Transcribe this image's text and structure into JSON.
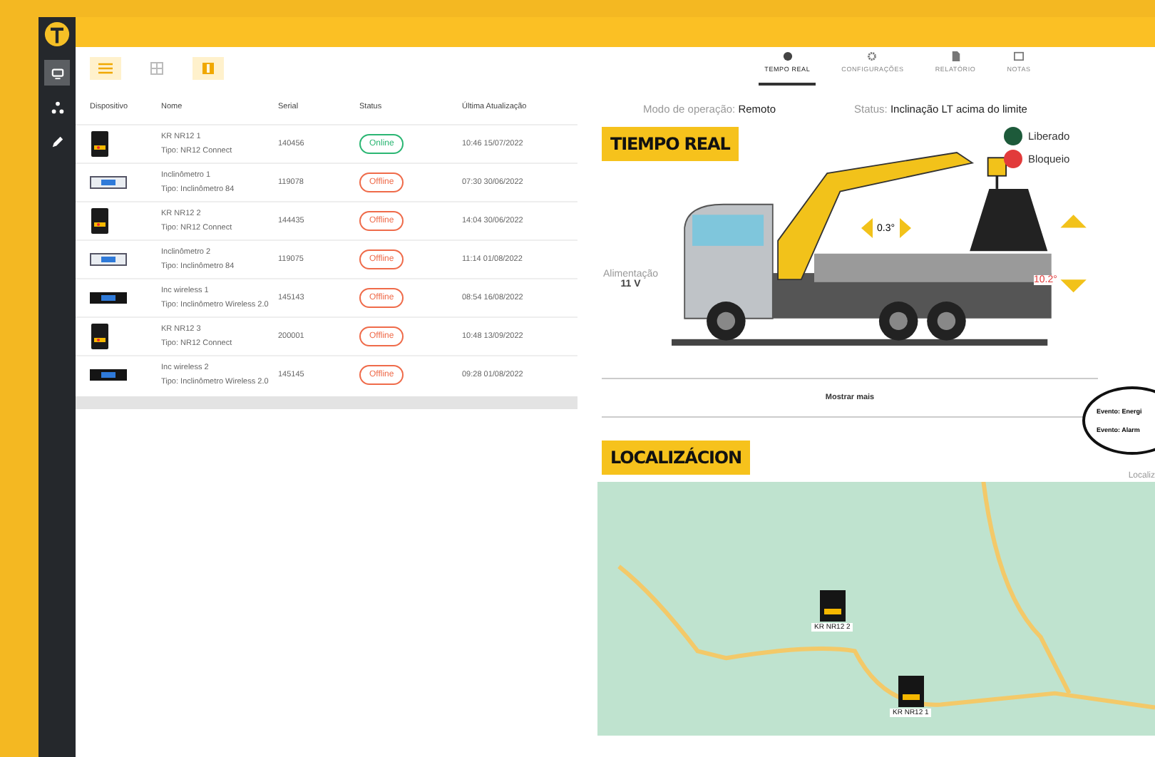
{
  "sidebar": {
    "items": [
      {
        "selected": true
      },
      {
        "selected": false
      },
      {
        "selected": false
      }
    ]
  },
  "view_toggles": [
    {
      "selected": true
    },
    {
      "selected": false
    },
    {
      "selected": true
    }
  ],
  "table": {
    "columns": [
      "Dispositivo",
      "Nome",
      "Serial",
      "Status",
      "Última Atualização"
    ],
    "rows": [
      {
        "kind": "nr12",
        "name": "KR NR12 1",
        "type": "Tipo: NR12 Connect",
        "serial": "140456",
        "status": "Online",
        "online": true,
        "updated": "10:46 15/07/2022"
      },
      {
        "kind": "inclinometer",
        "name": "Inclinômetro 1",
        "type": "Tipo: Inclinômetro 84",
        "serial": "119078",
        "status": "Offline",
        "online": false,
        "updated": "07:30 30/06/2022"
      },
      {
        "kind": "nr12",
        "name": "KR NR12 2",
        "type": "Tipo: NR12 Connect",
        "serial": "144435",
        "status": "Offline",
        "online": false,
        "updated": "14:04 30/06/2022"
      },
      {
        "kind": "inclinometer",
        "name": "Inclinômetro 2",
        "type": "Tipo: Inclinômetro 84",
        "serial": "119075",
        "status": "Offline",
        "online": false,
        "updated": "11:14 01/08/2022"
      },
      {
        "kind": "wireless",
        "name": "Inc wireless 1",
        "type": "Tipo: Inclinômetro Wireless 2.0",
        "serial": "145143",
        "status": "Offline",
        "online": false,
        "updated": "08:54 16/08/2022"
      },
      {
        "kind": "nr12",
        "name": "KR NR12 3",
        "type": "Tipo: NR12 Connect",
        "serial": "200001",
        "status": "Offline",
        "online": false,
        "updated": "10:48 13/09/2022"
      },
      {
        "kind": "wireless",
        "name": "Inc wireless 2",
        "type": "Tipo: Inclinômetro Wireless 2.0",
        "serial": "145145",
        "status": "Offline",
        "online": false,
        "updated": "09:28 01/08/2022"
      }
    ]
  },
  "tabs": [
    {
      "label": "TEMPO REAL",
      "selected": true
    },
    {
      "label": "CONFIGURAÇÕES",
      "selected": false
    },
    {
      "label": "RELATÓRIO",
      "selected": false
    },
    {
      "label": "NOTAS",
      "selected": false
    }
  ],
  "operation_mode": {
    "label": "Modo de operação:",
    "value": "Remoto"
  },
  "status": {
    "label": "Status:",
    "value": "Inclinação LT acima do limite"
  },
  "realtime_heading": "TIEMPO REAL",
  "legend": [
    {
      "label": "Liberado",
      "color": "#1d5a3a"
    },
    {
      "label": "Bloqueio",
      "color": "#e23b3b"
    }
  ],
  "power": {
    "label": "Alimentação",
    "value": "11 V"
  },
  "crane_angle": "0.3°",
  "tilt_angle": "10.2°",
  "show_more": "Mostrar mais",
  "events": [
    "Evento: Energi",
    "Evento: Alarm"
  ],
  "location_heading": "LOCALIZÁCION",
  "location_side": "Localiz",
  "map_markers": [
    {
      "label": "KR NR12 2"
    },
    {
      "label": "KR NR12 1"
    }
  ]
}
